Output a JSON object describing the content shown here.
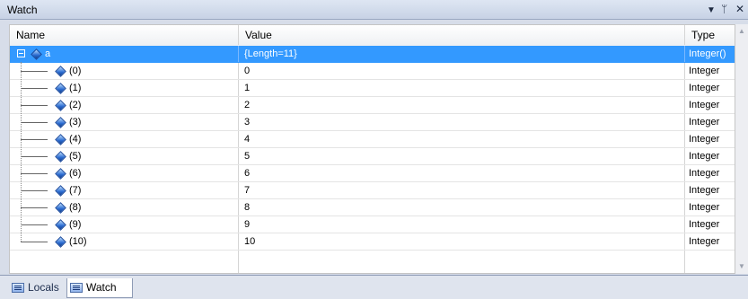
{
  "window": {
    "title": "Watch"
  },
  "titlebar_icons": {
    "dropdown": "▼",
    "pin": "ᚁ",
    "close": "✕"
  },
  "columns": {
    "name": "Name",
    "value": "Value",
    "type": "Type"
  },
  "parent": {
    "name": "a",
    "value": "{Length=11}",
    "type": "Integer()"
  },
  "children": [
    {
      "name": "(0)",
      "value": "0",
      "type": "Integer"
    },
    {
      "name": "(1)",
      "value": "1",
      "type": "Integer"
    },
    {
      "name": "(2)",
      "value": "2",
      "type": "Integer"
    },
    {
      "name": "(3)",
      "value": "3",
      "type": "Integer"
    },
    {
      "name": "(4)",
      "value": "4",
      "type": "Integer"
    },
    {
      "name": "(5)",
      "value": "5",
      "type": "Integer"
    },
    {
      "name": "(6)",
      "value": "6",
      "type": "Integer"
    },
    {
      "name": "(7)",
      "value": "7",
      "type": "Integer"
    },
    {
      "name": "(8)",
      "value": "8",
      "type": "Integer"
    },
    {
      "name": "(9)",
      "value": "9",
      "type": "Integer"
    },
    {
      "name": "(10)",
      "value": "10",
      "type": "Integer"
    }
  ],
  "tabs": {
    "locals": "Locals",
    "watch": "Watch"
  },
  "colors": {
    "selection": "#3399ff",
    "titlebar": "#c7d2e5"
  }
}
